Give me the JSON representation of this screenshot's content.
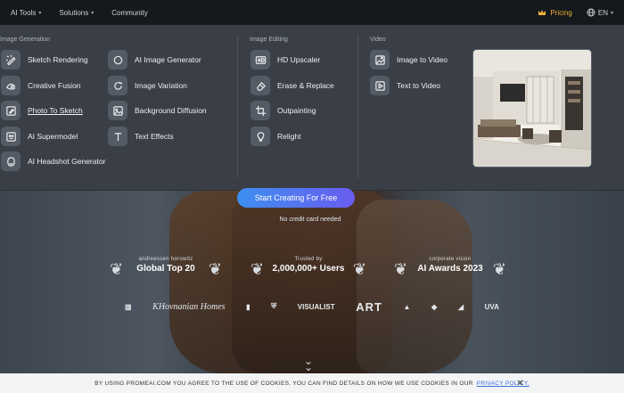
{
  "nav": {
    "ai_tools": "AI Tools",
    "solutions": "Solutions",
    "community": "Community",
    "pricing": "Pricing",
    "language": "EN"
  },
  "menu": {
    "image_generation": {
      "title": "Image Generation",
      "col1": [
        "Sketch Rendering",
        "Creative Fusion",
        "Photo To Sketch",
        "AI Supermodel",
        "AI Headshot Generator"
      ],
      "col2": [
        "AI Image Generator",
        "Image Variation",
        "Background Diffusion",
        "Text Effects"
      ]
    },
    "image_editing": {
      "title": "Image Editing",
      "items": [
        "HD Upscaler",
        "Erase & Replace",
        "Outpainting",
        "Relight"
      ]
    },
    "video": {
      "title": "Video",
      "items": [
        "Image to Video",
        "Text to Video"
      ]
    }
  },
  "hero": {
    "cta": "Start Creating For Free",
    "subcta": "No credit card needed"
  },
  "awards": [
    {
      "small": "andreessen horowitz",
      "big": "Global Top 20"
    },
    {
      "small": "Trusted by",
      "big": "2,000,000+ Users"
    },
    {
      "small": "corporate vision",
      "big": "AI Awards 2023"
    }
  ],
  "logos": [
    "KHovnanian Homes",
    "VISUALIST",
    "ART",
    "UVA"
  ],
  "cookie": {
    "text": "BY USING PROMEAI.COM YOU AGREE TO THE USE OF COOKIES. YOU CAN FIND DETAILS ON HOW WE USE COOKIES IN OUR",
    "link": "PRIVACY POLICY.",
    "close": "✕"
  },
  "colors": {
    "accent": "#f0b43a",
    "cta_start": "#3d8ff0",
    "cta_end": "#6a5cf0",
    "menu_bg": "#3a3f47"
  }
}
